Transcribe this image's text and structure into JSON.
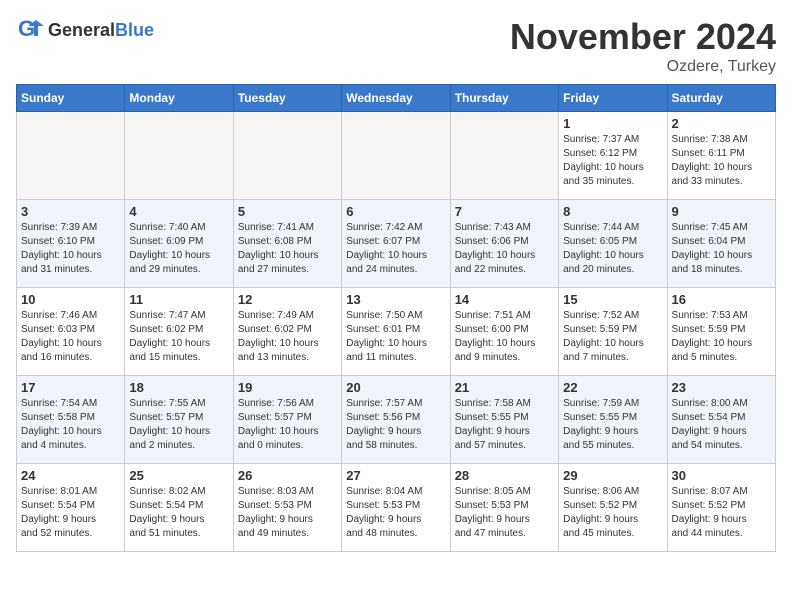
{
  "header": {
    "logo_general": "General",
    "logo_blue": "Blue",
    "month_title": "November 2024",
    "location": "Ozdere, Turkey"
  },
  "days_of_week": [
    "Sunday",
    "Monday",
    "Tuesday",
    "Wednesday",
    "Thursday",
    "Friday",
    "Saturday"
  ],
  "weeks": [
    [
      {
        "day": "",
        "info": ""
      },
      {
        "day": "",
        "info": ""
      },
      {
        "day": "",
        "info": ""
      },
      {
        "day": "",
        "info": ""
      },
      {
        "day": "",
        "info": ""
      },
      {
        "day": "1",
        "info": "Sunrise: 7:37 AM\nSunset: 6:12 PM\nDaylight: 10 hours\nand 35 minutes."
      },
      {
        "day": "2",
        "info": "Sunrise: 7:38 AM\nSunset: 6:11 PM\nDaylight: 10 hours\nand 33 minutes."
      }
    ],
    [
      {
        "day": "3",
        "info": "Sunrise: 7:39 AM\nSunset: 6:10 PM\nDaylight: 10 hours\nand 31 minutes."
      },
      {
        "day": "4",
        "info": "Sunrise: 7:40 AM\nSunset: 6:09 PM\nDaylight: 10 hours\nand 29 minutes."
      },
      {
        "day": "5",
        "info": "Sunrise: 7:41 AM\nSunset: 6:08 PM\nDaylight: 10 hours\nand 27 minutes."
      },
      {
        "day": "6",
        "info": "Sunrise: 7:42 AM\nSunset: 6:07 PM\nDaylight: 10 hours\nand 24 minutes."
      },
      {
        "day": "7",
        "info": "Sunrise: 7:43 AM\nSunset: 6:06 PM\nDaylight: 10 hours\nand 22 minutes."
      },
      {
        "day": "8",
        "info": "Sunrise: 7:44 AM\nSunset: 6:05 PM\nDaylight: 10 hours\nand 20 minutes."
      },
      {
        "day": "9",
        "info": "Sunrise: 7:45 AM\nSunset: 6:04 PM\nDaylight: 10 hours\nand 18 minutes."
      }
    ],
    [
      {
        "day": "10",
        "info": "Sunrise: 7:46 AM\nSunset: 6:03 PM\nDaylight: 10 hours\nand 16 minutes."
      },
      {
        "day": "11",
        "info": "Sunrise: 7:47 AM\nSunset: 6:02 PM\nDaylight: 10 hours\nand 15 minutes."
      },
      {
        "day": "12",
        "info": "Sunrise: 7:49 AM\nSunset: 6:02 PM\nDaylight: 10 hours\nand 13 minutes."
      },
      {
        "day": "13",
        "info": "Sunrise: 7:50 AM\nSunset: 6:01 PM\nDaylight: 10 hours\nand 11 minutes."
      },
      {
        "day": "14",
        "info": "Sunrise: 7:51 AM\nSunset: 6:00 PM\nDaylight: 10 hours\nand 9 minutes."
      },
      {
        "day": "15",
        "info": "Sunrise: 7:52 AM\nSunset: 5:59 PM\nDaylight: 10 hours\nand 7 minutes."
      },
      {
        "day": "16",
        "info": "Sunrise: 7:53 AM\nSunset: 5:59 PM\nDaylight: 10 hours\nand 5 minutes."
      }
    ],
    [
      {
        "day": "17",
        "info": "Sunrise: 7:54 AM\nSunset: 5:58 PM\nDaylight: 10 hours\nand 4 minutes."
      },
      {
        "day": "18",
        "info": "Sunrise: 7:55 AM\nSunset: 5:57 PM\nDaylight: 10 hours\nand 2 minutes."
      },
      {
        "day": "19",
        "info": "Sunrise: 7:56 AM\nSunset: 5:57 PM\nDaylight: 10 hours\nand 0 minutes."
      },
      {
        "day": "20",
        "info": "Sunrise: 7:57 AM\nSunset: 5:56 PM\nDaylight: 9 hours\nand 58 minutes."
      },
      {
        "day": "21",
        "info": "Sunrise: 7:58 AM\nSunset: 5:55 PM\nDaylight: 9 hours\nand 57 minutes."
      },
      {
        "day": "22",
        "info": "Sunrise: 7:59 AM\nSunset: 5:55 PM\nDaylight: 9 hours\nand 55 minutes."
      },
      {
        "day": "23",
        "info": "Sunrise: 8:00 AM\nSunset: 5:54 PM\nDaylight: 9 hours\nand 54 minutes."
      }
    ],
    [
      {
        "day": "24",
        "info": "Sunrise: 8:01 AM\nSunset: 5:54 PM\nDaylight: 9 hours\nand 52 minutes."
      },
      {
        "day": "25",
        "info": "Sunrise: 8:02 AM\nSunset: 5:54 PM\nDaylight: 9 hours\nand 51 minutes."
      },
      {
        "day": "26",
        "info": "Sunrise: 8:03 AM\nSunset: 5:53 PM\nDaylight: 9 hours\nand 49 minutes."
      },
      {
        "day": "27",
        "info": "Sunrise: 8:04 AM\nSunset: 5:53 PM\nDaylight: 9 hours\nand 48 minutes."
      },
      {
        "day": "28",
        "info": "Sunrise: 8:05 AM\nSunset: 5:53 PM\nDaylight: 9 hours\nand 47 minutes."
      },
      {
        "day": "29",
        "info": "Sunrise: 8:06 AM\nSunset: 5:52 PM\nDaylight: 9 hours\nand 45 minutes."
      },
      {
        "day": "30",
        "info": "Sunrise: 8:07 AM\nSunset: 5:52 PM\nDaylight: 9 hours\nand 44 minutes."
      }
    ]
  ]
}
